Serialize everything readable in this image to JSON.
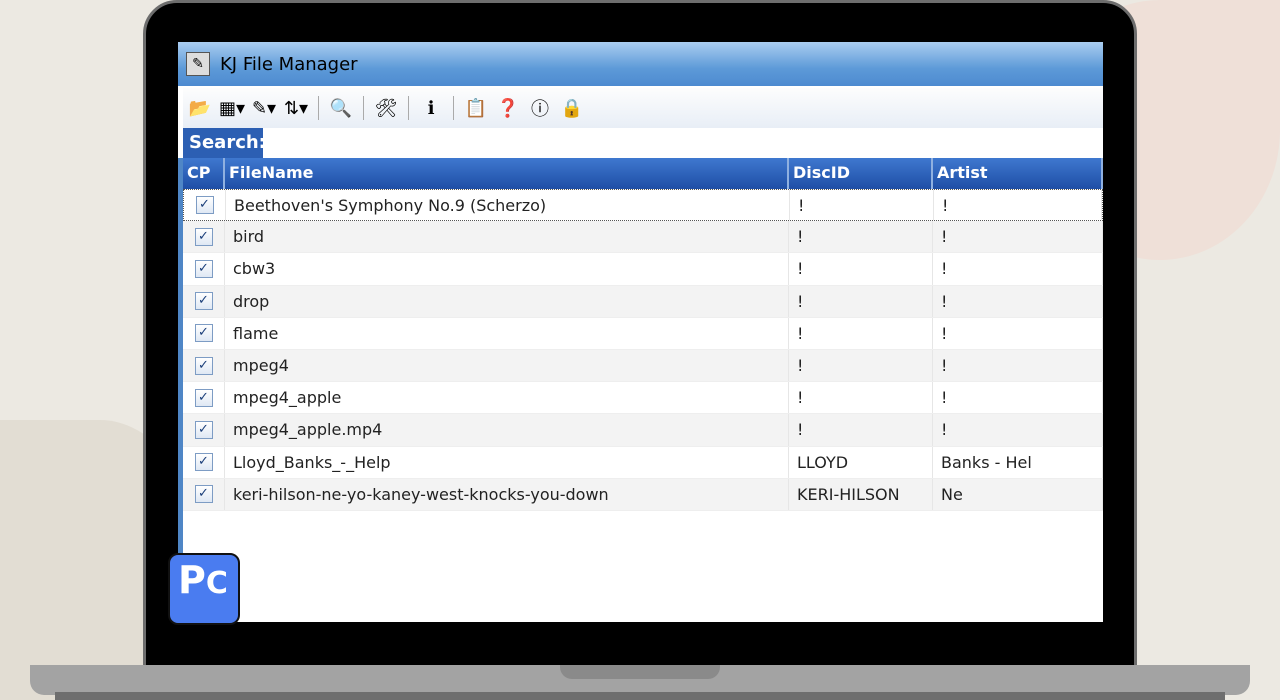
{
  "window": {
    "title": "KJ File Manager"
  },
  "search": {
    "label": "Search:",
    "value": ""
  },
  "columns": [
    "CP",
    "FileName",
    "DiscID",
    "Artist"
  ],
  "rows": [
    {
      "checked": true,
      "filename": "Beethoven's Symphony No.9 (Scherzo)",
      "discid": "!",
      "artist": "!"
    },
    {
      "checked": true,
      "filename": "bird",
      "discid": "!",
      "artist": "!"
    },
    {
      "checked": true,
      "filename": "cbw3",
      "discid": "!",
      "artist": "!"
    },
    {
      "checked": true,
      "filename": "drop",
      "discid": "!",
      "artist": "!"
    },
    {
      "checked": true,
      "filename": "flame",
      "discid": "!",
      "artist": "!"
    },
    {
      "checked": true,
      "filename": "mpeg4",
      "discid": "!",
      "artist": "!"
    },
    {
      "checked": true,
      "filename": "mpeg4_apple",
      "discid": "!",
      "artist": "!"
    },
    {
      "checked": true,
      "filename": "mpeg4_apple.mp4",
      "discid": "!",
      "artist": "!"
    },
    {
      "checked": true,
      "filename": "Lloyd_Banks_-_Help",
      "discid": "LLOYD",
      "artist": "Banks - Hel"
    },
    {
      "checked": true,
      "filename": "keri-hilson-ne-yo-kaney-west-knocks-you-down",
      "discid": "KERI-HILSON",
      "artist": "Ne"
    }
  ],
  "toolbar": [
    {
      "name": "open-folder-icon",
      "glyph": "📂"
    },
    {
      "name": "table-view-icon",
      "glyph": "▦▾"
    },
    {
      "name": "edit-icon",
      "glyph": "✎▾"
    },
    {
      "name": "sort-az-icon",
      "glyph": "⇅▾"
    },
    {
      "name": "search-icon",
      "glyph": "🔍"
    },
    {
      "name": "tools-icon",
      "glyph": "🛠"
    },
    {
      "name": "info-i-icon",
      "glyph": "ℹ"
    },
    {
      "name": "properties-icon",
      "glyph": "📋"
    },
    {
      "name": "help-icon",
      "glyph": "❓"
    },
    {
      "name": "about-icon",
      "glyph": "ⓘ"
    },
    {
      "name": "lock-user-icon",
      "glyph": "🔒"
    }
  ],
  "watermark": "PC"
}
